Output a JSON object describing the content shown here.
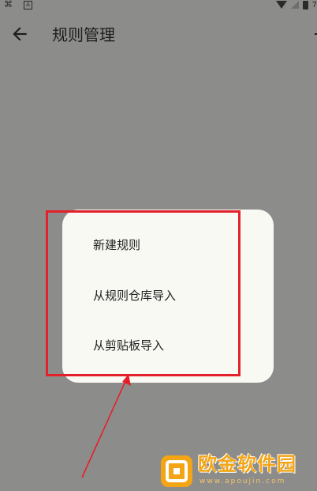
{
  "status_bar": {
    "left_icon": "usb-debug-icon",
    "a_icon_label": "A",
    "battery_text": "7"
  },
  "app_bar": {
    "back_icon": "arrow-left-icon",
    "title": "规则管理",
    "add_icon": "plus-icon"
  },
  "menu": {
    "items": [
      {
        "label": "新建规则"
      },
      {
        "label": "从规则仓库导入"
      },
      {
        "label": "从剪贴板导入"
      }
    ]
  },
  "watermark": {
    "name": "欧金软件园",
    "url": "www.apoujin.com"
  },
  "colors": {
    "scrim_background": "#8c8d8a",
    "menu_background": "#f8f9f3",
    "annotation_red": "#e4202b",
    "watermark_orange": "#f3a515"
  }
}
